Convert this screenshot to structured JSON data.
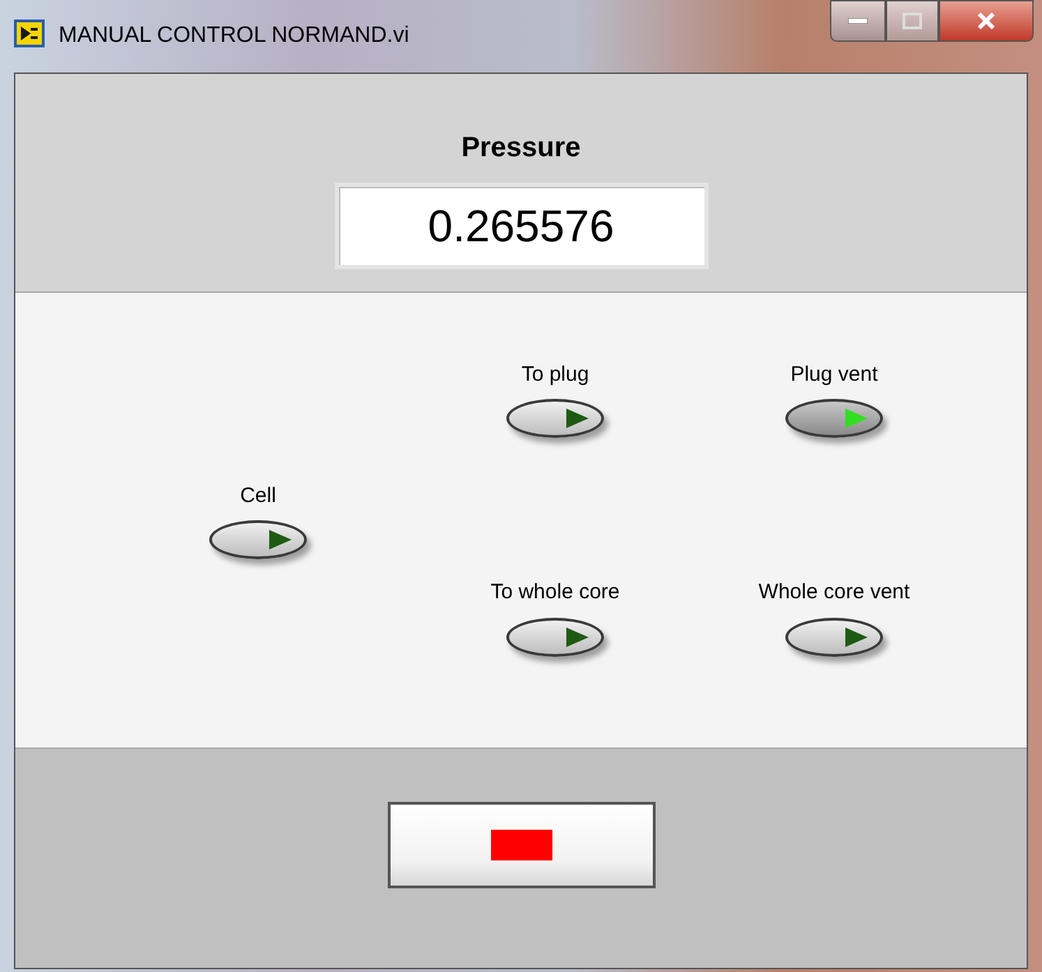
{
  "window": {
    "title": "MANUAL CONTROL NORMAND.vi"
  },
  "pressure": {
    "label": "Pressure",
    "value": "0.265576"
  },
  "valves": [
    {
      "label": "To plug",
      "lit": false
    },
    {
      "label": "Plug vent",
      "lit": true
    },
    {
      "label": "Cell",
      "lit": false
    },
    {
      "label": "To whole core",
      "lit": false
    },
    {
      "label": "Whole core vent",
      "lit": false
    }
  ],
  "stop_button": {
    "lit": true
  }
}
